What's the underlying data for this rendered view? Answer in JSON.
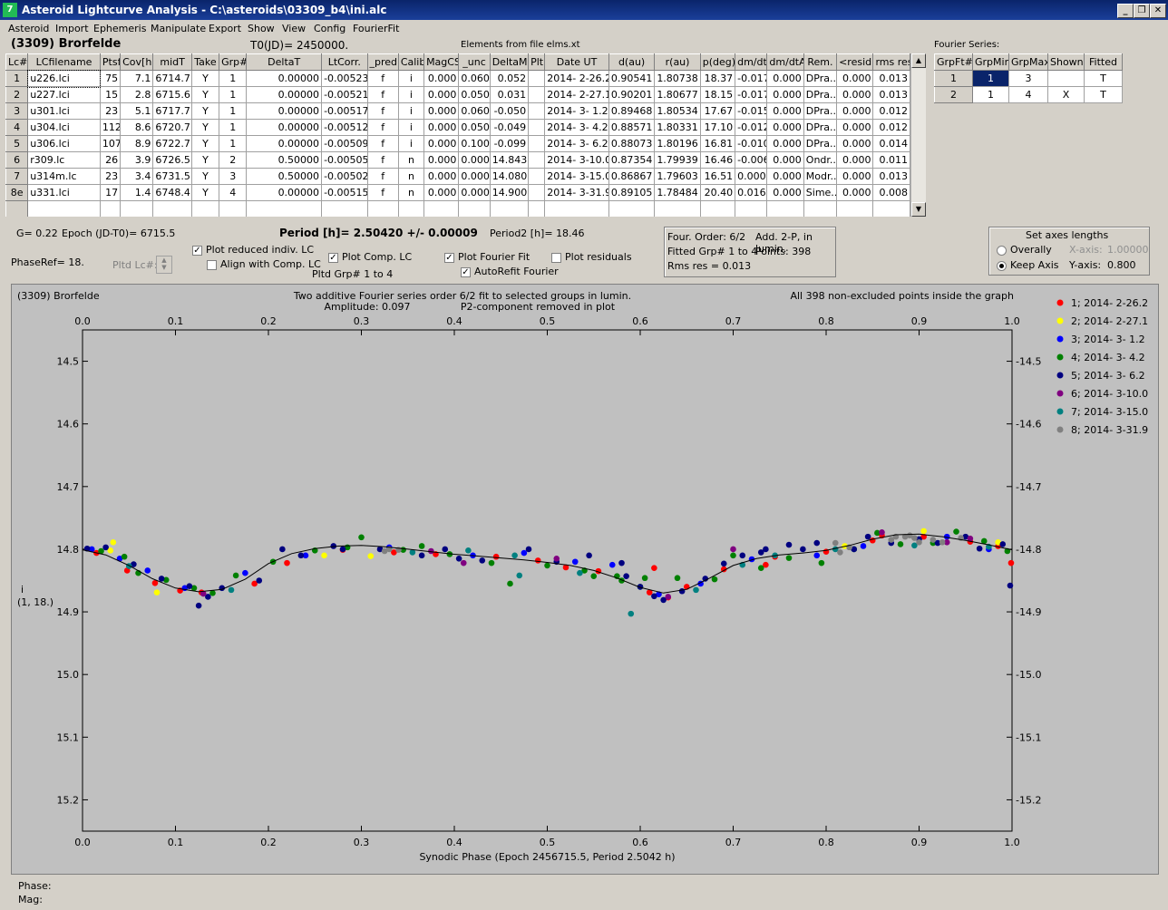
{
  "window": {
    "title": "Asteroid Lightcurve Analysis - C:\\asteroids\\03309_b4\\ini.alc",
    "app_icon": "7",
    "buttons": {
      "minimize": "_",
      "restore": "❐",
      "close": "✕"
    }
  },
  "menu": [
    "Asteroid",
    "Import",
    "Ephemeris",
    "Manipulate",
    "Export",
    "Show",
    "View",
    "Config",
    "FourierFit"
  ],
  "header": {
    "asteroid_name": "(3309) Brorfelde",
    "t0": "T0(JD)= 2450000.",
    "elements": "Elements from file elms.xt",
    "fourier_series_label": "Fourier Series:"
  },
  "lc_table": {
    "columns": [
      "Lc#",
      "LCfilename",
      "Ptsf",
      "Cov[h]",
      "midT",
      "Take",
      "Grp#",
      "DeltaT",
      "LtCorr.",
      "_pred.",
      "Calib.",
      "MagCS",
      "_unc",
      "DeltaM",
      "Plt",
      "Date UT",
      "d(au)",
      "r(au)",
      "p(deg)",
      "dm/dt",
      "dm/dtA",
      "Rem.",
      "<resid>",
      "rms res"
    ],
    "rows": [
      [
        "1",
        "u226.lci",
        "75",
        "7.1",
        "6714.7",
        "Y",
        "1",
        "0.00000",
        "-0.00523",
        "f",
        "i",
        "0.000",
        "0.060",
        "0.052",
        "",
        "2014- 2-26.2",
        "0.90541",
        "1.80738",
        "18.37",
        "-0.017",
        "0.000",
        "DPra...",
        "0.000",
        "0.013"
      ],
      [
        "2",
        "u227.lci",
        "15",
        "2.8",
        "6715.6",
        "Y",
        "1",
        "0.00000",
        "-0.00521",
        "f",
        "i",
        "0.000",
        "0.050",
        "0.031",
        "",
        "2014- 2-27.1",
        "0.90201",
        "1.80677",
        "18.15",
        "-0.017",
        "0.000",
        "DPra...",
        "0.000",
        "0.013"
      ],
      [
        "3",
        "u301.lci",
        "23",
        "5.1",
        "6717.7",
        "Y",
        "1",
        "0.00000",
        "-0.00517",
        "f",
        "i",
        "0.000",
        "0.060",
        "-0.050",
        "",
        "2014- 3- 1.2",
        "0.89468",
        "1.80534",
        "17.67",
        "-0.015",
        "0.000",
        "DPra...",
        "0.000",
        "0.012"
      ],
      [
        "4",
        "u304.lci",
        "112",
        "8.6",
        "6720.7",
        "Y",
        "1",
        "0.00000",
        "-0.00512",
        "f",
        "i",
        "0.000",
        "0.050",
        "-0.049",
        "",
        "2014- 3- 4.2",
        "0.88571",
        "1.80331",
        "17.10",
        "-0.012",
        "0.000",
        "DPra...",
        "0.000",
        "0.012"
      ],
      [
        "5",
        "u306.lci",
        "107",
        "8.9",
        "6722.7",
        "Y",
        "1",
        "0.00000",
        "-0.00509",
        "f",
        "i",
        "0.000",
        "0.100",
        "-0.099",
        "",
        "2014- 3- 6.2",
        "0.88073",
        "1.80196",
        "16.81",
        "-0.010",
        "0.000",
        "DPra...",
        "0.000",
        "0.014"
      ],
      [
        "6",
        "r309.lc",
        "26",
        "3.9",
        "6726.5",
        "Y",
        "2",
        "0.50000",
        "-0.00505",
        "f",
        "n",
        "0.000",
        "0.000",
        "14.843",
        "",
        "2014- 3-10.0",
        "0.87354",
        "1.79939",
        "16.46",
        "-0.006",
        "0.000",
        "Ondr...",
        "0.000",
        "0.011"
      ],
      [
        "7",
        "u314m.lc",
        "23",
        "3.4",
        "6731.5",
        "Y",
        "3",
        "0.50000",
        "-0.00502",
        "f",
        "n",
        "0.000",
        "0.000",
        "14.080",
        "",
        "2014- 3-15.0",
        "0.86867",
        "1.79603",
        "16.51",
        "0.000",
        "0.000",
        "Modr...",
        "0.000",
        "0.013"
      ],
      [
        "8e",
        "u331.lci",
        "17",
        "1.4",
        "6748.4",
        "Y",
        "4",
        "0.00000",
        "-0.00515",
        "f",
        "n",
        "0.000",
        "0.000",
        "14.900",
        "",
        "2014- 3-31.9",
        "0.89105",
        "1.78484",
        "20.40",
        "0.016",
        "0.000",
        "Sime...",
        "0.000",
        "0.008"
      ]
    ]
  },
  "fourier_table": {
    "columns": [
      "GrpFt#",
      "GrpMin",
      "GrpMax",
      "Shown",
      "Fitted"
    ],
    "rows": [
      [
        "1",
        "1",
        "3",
        "",
        "T"
      ],
      [
        "2",
        "1",
        "4",
        "X",
        "T"
      ]
    ]
  },
  "controls": {
    "g_value": "G= 0.22",
    "epoch": "Epoch (JD-T0)= 6715.5",
    "period": "Period [h]= 2.50420 +/- 0.00009",
    "period2": "Period2 [h]= 18.46",
    "phase_ref": "PhaseRef= 18.",
    "pltd_lc": "Pltd Lc#:",
    "plot_reduced": "Plot reduced indiv. LC",
    "align_comp": "Align with Comp. LC",
    "plot_comp": "Plot Comp. LC",
    "pltd_grp": "Pltd Grp#  1   to   4",
    "plot_fourier": "Plot Fourier Fit",
    "autorefit": "AutoRefit Fourier",
    "plot_residuals": "Plot residuals",
    "info": {
      "four_order": "Four. Order:  6/2",
      "add": "Add. 2-P, in lumin.",
      "fitted": "Fitted Grp# 1 to 4",
      "points": "Points: 398",
      "rms": "Rms res    = 0.013"
    },
    "axes": {
      "title": "Set axes lengths",
      "overally": "Overally",
      "keep": "Keep Axis",
      "xaxis_label": "X-axis:",
      "xaxis_value": "1.00000",
      "yaxis_label": "Y-axis:",
      "yaxis_value": "0.800"
    }
  },
  "chart_data": {
    "type": "scatter",
    "corner_label": "(3309) Brorfelde",
    "title": "Two additive Fourier series order 6/2 fit to selected groups in lumin.",
    "subtitle_left": "Amplitude: 0.097",
    "subtitle_right": "P2-component removed in plot",
    "note_right": "All 398 non-excluded points inside the graph",
    "xlabel": "Synodic Phase (Epoch 2456715.5, Period 2.5042 h)",
    "ylabel": "i",
    "ylabel2": "(1, 18.)",
    "xlim": [
      0.0,
      1.0
    ],
    "ylim": [
      14.45,
      15.25
    ],
    "y_inverted": true,
    "xticks": [
      "0.0",
      "0.1",
      "0.2",
      "0.3",
      "0.4",
      "0.5",
      "0.6",
      "0.7",
      "0.8",
      "0.9",
      "1.0"
    ],
    "yticks": [
      "14.5",
      "14.6",
      "14.7",
      "14.8",
      "14.9",
      "15.0",
      "15.1",
      "15.2"
    ],
    "fit_curve": {
      "x": [
        0.0,
        0.025,
        0.05,
        0.075,
        0.1,
        0.125,
        0.15,
        0.175,
        0.2,
        0.225,
        0.25,
        0.275,
        0.3,
        0.325,
        0.35,
        0.375,
        0.4,
        0.425,
        0.45,
        0.475,
        0.5,
        0.525,
        0.55,
        0.575,
        0.6,
        0.625,
        0.65,
        0.675,
        0.7,
        0.725,
        0.75,
        0.775,
        0.8,
        0.825,
        0.85,
        0.875,
        0.9,
        0.925,
        0.95,
        0.975,
        1.0
      ],
      "y": [
        14.801,
        14.809,
        14.826,
        14.847,
        14.862,
        14.868,
        14.864,
        14.848,
        14.823,
        14.807,
        14.799,
        14.795,
        14.794,
        14.796,
        14.8,
        14.804,
        14.808,
        14.811,
        14.814,
        14.817,
        14.821,
        14.826,
        14.834,
        14.846,
        14.861,
        14.87,
        14.864,
        14.846,
        14.826,
        14.815,
        14.809,
        14.806,
        14.802,
        14.794,
        14.784,
        14.777,
        14.776,
        14.78,
        14.786,
        14.793,
        14.801
      ]
    },
    "series": [
      {
        "name": "1; 2014- 2-26.2",
        "color": "#ff0000",
        "points": [
          [
            0.015,
            14.806
          ],
          [
            0.048,
            14.834
          ],
          [
            0.078,
            14.854
          ],
          [
            0.105,
            14.866
          ],
          [
            0.128,
            14.869
          ],
          [
            0.22,
            14.822
          ],
          [
            0.28,
            14.801
          ],
          [
            0.335,
            14.805
          ],
          [
            0.38,
            14.808
          ],
          [
            0.445,
            14.812
          ],
          [
            0.49,
            14.818
          ],
          [
            0.52,
            14.829
          ],
          [
            0.555,
            14.835
          ],
          [
            0.61,
            14.869
          ],
          [
            0.63,
            14.877
          ],
          [
            0.65,
            14.86
          ],
          [
            0.69,
            14.832
          ],
          [
            0.745,
            14.812
          ],
          [
            0.8,
            14.804
          ],
          [
            0.85,
            14.786
          ],
          [
            0.905,
            14.78
          ],
          [
            0.955,
            14.788
          ],
          [
            0.985,
            14.795
          ],
          [
            0.999,
            14.822
          ],
          [
            0.185,
            14.855
          ],
          [
            0.615,
            14.83
          ],
          [
            0.735,
            14.825
          ],
          [
            0.86,
            14.778
          ]
        ]
      },
      {
        "name": "2; 2014- 2-27.1",
        "color": "#ffff00",
        "points": [
          [
            0.03,
            14.802
          ],
          [
            0.033,
            14.789
          ],
          [
            0.26,
            14.81
          ],
          [
            0.31,
            14.811
          ],
          [
            0.82,
            14.795
          ],
          [
            0.905,
            14.771
          ],
          [
            0.985,
            14.789
          ],
          [
            0.08,
            14.869
          ]
        ]
      },
      {
        "name": "3; 2014- 3- 1.2",
        "color": "#0000ff",
        "points": [
          [
            0.01,
            14.8
          ],
          [
            0.04,
            14.815
          ],
          [
            0.07,
            14.834
          ],
          [
            0.11,
            14.862
          ],
          [
            0.175,
            14.838
          ],
          [
            0.24,
            14.81
          ],
          [
            0.33,
            14.797
          ],
          [
            0.42,
            14.81
          ],
          [
            0.475,
            14.806
          ],
          [
            0.53,
            14.82
          ],
          [
            0.57,
            14.825
          ],
          [
            0.62,
            14.872
          ],
          [
            0.665,
            14.855
          ],
          [
            0.72,
            14.816
          ],
          [
            0.79,
            14.81
          ],
          [
            0.84,
            14.795
          ],
          [
            0.93,
            14.78
          ],
          [
            0.975,
            14.8
          ]
        ]
      },
      {
        "name": "4; 2014- 3- 4.2",
        "color": "#008000",
        "points": [
          [
            0.02,
            14.803
          ],
          [
            0.045,
            14.812
          ],
          [
            0.06,
            14.838
          ],
          [
            0.09,
            14.849
          ],
          [
            0.12,
            14.862
          ],
          [
            0.14,
            14.87
          ],
          [
            0.165,
            14.842
          ],
          [
            0.205,
            14.82
          ],
          [
            0.25,
            14.802
          ],
          [
            0.285,
            14.797
          ],
          [
            0.3,
            14.781
          ],
          [
            0.345,
            14.801
          ],
          [
            0.395,
            14.808
          ],
          [
            0.44,
            14.822
          ],
          [
            0.46,
            14.855
          ],
          [
            0.5,
            14.826
          ],
          [
            0.54,
            14.834
          ],
          [
            0.55,
            14.843
          ],
          [
            0.58,
            14.85
          ],
          [
            0.6,
            14.86
          ],
          [
            0.64,
            14.846
          ],
          [
            0.68,
            14.848
          ],
          [
            0.7,
            14.81
          ],
          [
            0.73,
            14.83
          ],
          [
            0.76,
            14.814
          ],
          [
            0.795,
            14.822
          ],
          [
            0.83,
            14.8
          ],
          [
            0.855,
            14.774
          ],
          [
            0.88,
            14.792
          ],
          [
            0.915,
            14.79
          ],
          [
            0.94,
            14.772
          ],
          [
            0.97,
            14.787
          ],
          [
            0.995,
            14.803
          ],
          [
            0.575,
            14.843
          ],
          [
            0.365,
            14.795
          ],
          [
            0.605,
            14.846
          ]
        ]
      },
      {
        "name": "5; 2014- 3- 6.2",
        "color": "#000080",
        "points": [
          [
            0.005,
            14.799
          ],
          [
            0.025,
            14.797
          ],
          [
            0.055,
            14.824
          ],
          [
            0.085,
            14.847
          ],
          [
            0.115,
            14.859
          ],
          [
            0.125,
            14.89
          ],
          [
            0.135,
            14.876
          ],
          [
            0.15,
            14.862
          ],
          [
            0.19,
            14.85
          ],
          [
            0.215,
            14.8
          ],
          [
            0.235,
            14.81
          ],
          [
            0.27,
            14.795
          ],
          [
            0.32,
            14.8
          ],
          [
            0.365,
            14.81
          ],
          [
            0.405,
            14.815
          ],
          [
            0.43,
            14.818
          ],
          [
            0.48,
            14.8
          ],
          [
            0.51,
            14.82
          ],
          [
            0.545,
            14.81
          ],
          [
            0.585,
            14.843
          ],
          [
            0.6,
            14.86
          ],
          [
            0.615,
            14.875
          ],
          [
            0.625,
            14.881
          ],
          [
            0.645,
            14.867
          ],
          [
            0.67,
            14.847
          ],
          [
            0.69,
            14.823
          ],
          [
            0.71,
            14.81
          ],
          [
            0.735,
            14.8
          ],
          [
            0.76,
            14.793
          ],
          [
            0.775,
            14.8
          ],
          [
            0.79,
            14.79
          ],
          [
            0.83,
            14.8
          ],
          [
            0.87,
            14.79
          ],
          [
            0.9,
            14.784
          ],
          [
            0.92,
            14.79
          ],
          [
            0.95,
            14.78
          ],
          [
            0.965,
            14.799
          ],
          [
            0.99,
            14.792
          ],
          [
            0.998,
            14.858
          ],
          [
            0.845,
            14.78
          ],
          [
            0.73,
            14.805
          ],
          [
            0.58,
            14.822
          ],
          [
            0.39,
            14.8
          ],
          [
            0.28,
            14.8
          ]
        ]
      },
      {
        "name": "6; 2014- 3-10.0",
        "color": "#800080",
        "points": [
          [
            0.13,
            14.871
          ],
          [
            0.375,
            14.803
          ],
          [
            0.41,
            14.822
          ],
          [
            0.51,
            14.815
          ],
          [
            0.63,
            14.876
          ],
          [
            0.7,
            14.8
          ],
          [
            0.86,
            14.773
          ],
          [
            0.93,
            14.789
          ],
          [
            0.955,
            14.783
          ]
        ]
      },
      {
        "name": "7; 2014- 3-15.0",
        "color": "#008080",
        "points": [
          [
            0.05,
            14.827
          ],
          [
            0.16,
            14.865
          ],
          [
            0.355,
            14.805
          ],
          [
            0.415,
            14.802
          ],
          [
            0.465,
            14.81
          ],
          [
            0.47,
            14.842
          ],
          [
            0.535,
            14.838
          ],
          [
            0.59,
            14.903
          ],
          [
            0.66,
            14.865
          ],
          [
            0.71,
            14.825
          ],
          [
            0.745,
            14.81
          ],
          [
            0.81,
            14.8
          ],
          [
            0.895,
            14.794
          ],
          [
            0.975,
            14.796
          ]
        ]
      },
      {
        "name": "8; 2014- 3-31.9",
        "color": "#808080",
        "points": [
          [
            0.33,
            14.8
          ],
          [
            0.325,
            14.803
          ],
          [
            0.34,
            14.801
          ],
          [
            0.81,
            14.79
          ],
          [
            0.815,
            14.805
          ],
          [
            0.825,
            14.797
          ],
          [
            0.87,
            14.785
          ],
          [
            0.875,
            14.78
          ],
          [
            0.885,
            14.78
          ],
          [
            0.89,
            14.778
          ],
          [
            0.895,
            14.782
          ],
          [
            0.9,
            14.789
          ],
          [
            0.915,
            14.785
          ],
          [
            0.925,
            14.789
          ],
          [
            0.945,
            14.782
          ]
        ]
      }
    ]
  },
  "status": {
    "phase": "Phase:",
    "mag": "Mag:"
  }
}
